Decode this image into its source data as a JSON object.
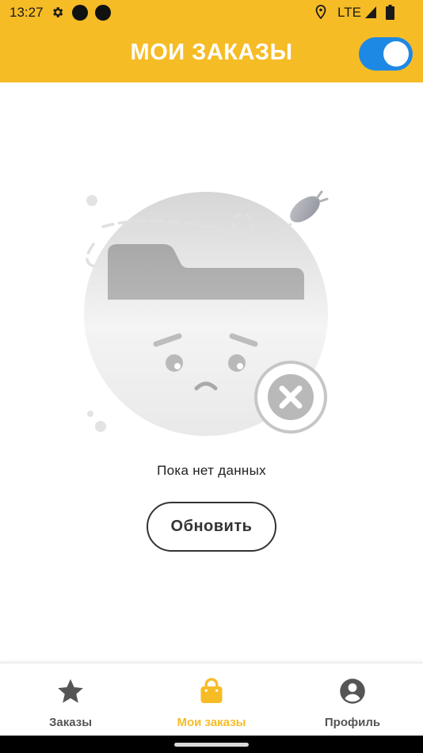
{
  "status_bar": {
    "time": "13:27",
    "network": "LTE",
    "icons": [
      "settings-gear-icon",
      "notification-dot-icon",
      "notification-dot-icon",
      "location-pin-icon",
      "signal-icon",
      "battery-icon"
    ]
  },
  "header": {
    "title": "МОИ ЗАКАЗЫ",
    "toggle_on": true,
    "background": "#F6BC26",
    "toggle_color": "#1E88E5"
  },
  "empty_state": {
    "illustration": "empty-folder-sad-face-icon",
    "message": "Пока нет данных",
    "refresh_label": "Обновить"
  },
  "bottom_nav": {
    "active_color": "#F6BC26",
    "inactive_color": "#555555",
    "items": [
      {
        "label": "Заказы",
        "icon": "star-icon",
        "active": false
      },
      {
        "label": "Мои заказы",
        "icon": "shopping-bag-icon",
        "active": true
      },
      {
        "label": "Профиль",
        "icon": "account-circle-icon",
        "active": false
      }
    ]
  }
}
